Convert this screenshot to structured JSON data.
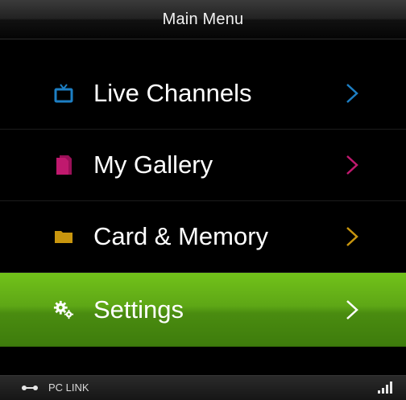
{
  "header": {
    "title": "Main Menu"
  },
  "menu": {
    "items": [
      {
        "label": "Live Channels",
        "icon": "tv-icon",
        "accent": "#1d7fc4"
      },
      {
        "label": "My Gallery",
        "icon": "gallery-icon",
        "accent": "#c0196e"
      },
      {
        "label": "Card & Memory",
        "icon": "folder-icon",
        "accent": "#c9960e"
      },
      {
        "label": "Settings",
        "icon": "gears-icon",
        "accent": "#ffffff",
        "selected": true
      }
    ]
  },
  "footer": {
    "pc_link_label": "PC LINK",
    "pc_link_icon": "usb-link-icon",
    "signal_icon": "signal-strength-icon"
  },
  "colors": {
    "selected_bg": "#5ea716",
    "background": "#000000"
  }
}
